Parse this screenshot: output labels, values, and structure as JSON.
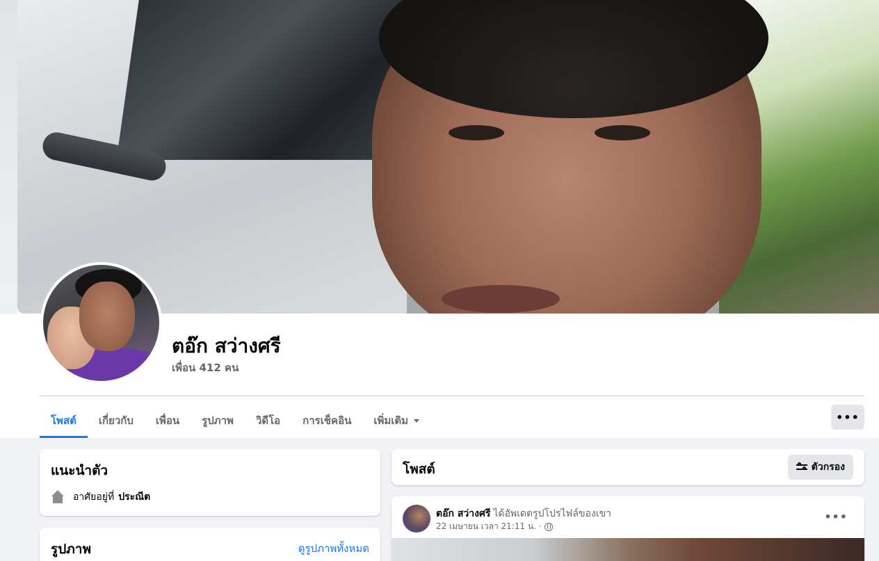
{
  "profile": {
    "name": "ตอ๊ก สว่างศรี",
    "friends": "เพื่อน 412 คน"
  },
  "tabs": [
    {
      "label": "โพสต์",
      "active": true
    },
    {
      "label": "เกี่ยวกับ"
    },
    {
      "label": "เพื่อน"
    },
    {
      "label": "รูปภาพ"
    },
    {
      "label": "วิดีโอ"
    },
    {
      "label": "การเช็คอิน"
    },
    {
      "label": "เพิ่มเติม"
    }
  ],
  "more_button": "•••",
  "intro": {
    "title": "แนะนำตัว",
    "lives_in_prefix": "อาศัยอยู่ที่",
    "lives_in_place": "ประณีต"
  },
  "photos": {
    "title": "รูปภาพ",
    "see_all": "ดูรูปภาพทั้งหมด"
  },
  "posts": {
    "title": "โพสต์",
    "filter_label": "ตัวกรอง"
  },
  "post": {
    "author": "ตอ๊ก สว่างศรี",
    "action": "ได้อัพเดตรูปโปรไฟล์ของเขา",
    "timestamp": "22 เมษายน เวลา 21:11 น. ·",
    "menu": "•••"
  },
  "colors": {
    "accent": "#1877f2",
    "background": "#f0f2f5",
    "secondary_text": "#65676b"
  }
}
